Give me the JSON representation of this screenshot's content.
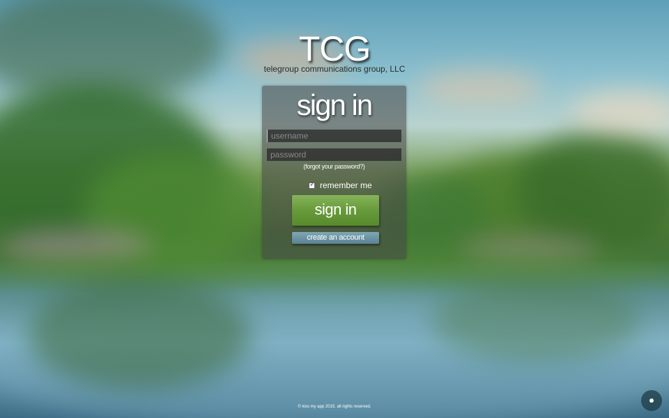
{
  "brand": {
    "logo": "TCG",
    "subtitle": "telegroup communications group, LLC"
  },
  "signin_panel": {
    "title": "sign in",
    "username_placeholder": "username",
    "password_placeholder": "password",
    "forgot_link": "(forgot your password?)",
    "remember_label": "remember me",
    "remember_checked": true,
    "signin_button": "sign in",
    "create_account_button": "create an account"
  },
  "footer": {
    "text": "© kiss my app 2015. all rights reserved."
  },
  "colors": {
    "signin_button": "#6a9c3d",
    "create_button": "#5b8293",
    "panel_background": "#464646"
  },
  "icons": {
    "corner_button": "dot-icon"
  }
}
